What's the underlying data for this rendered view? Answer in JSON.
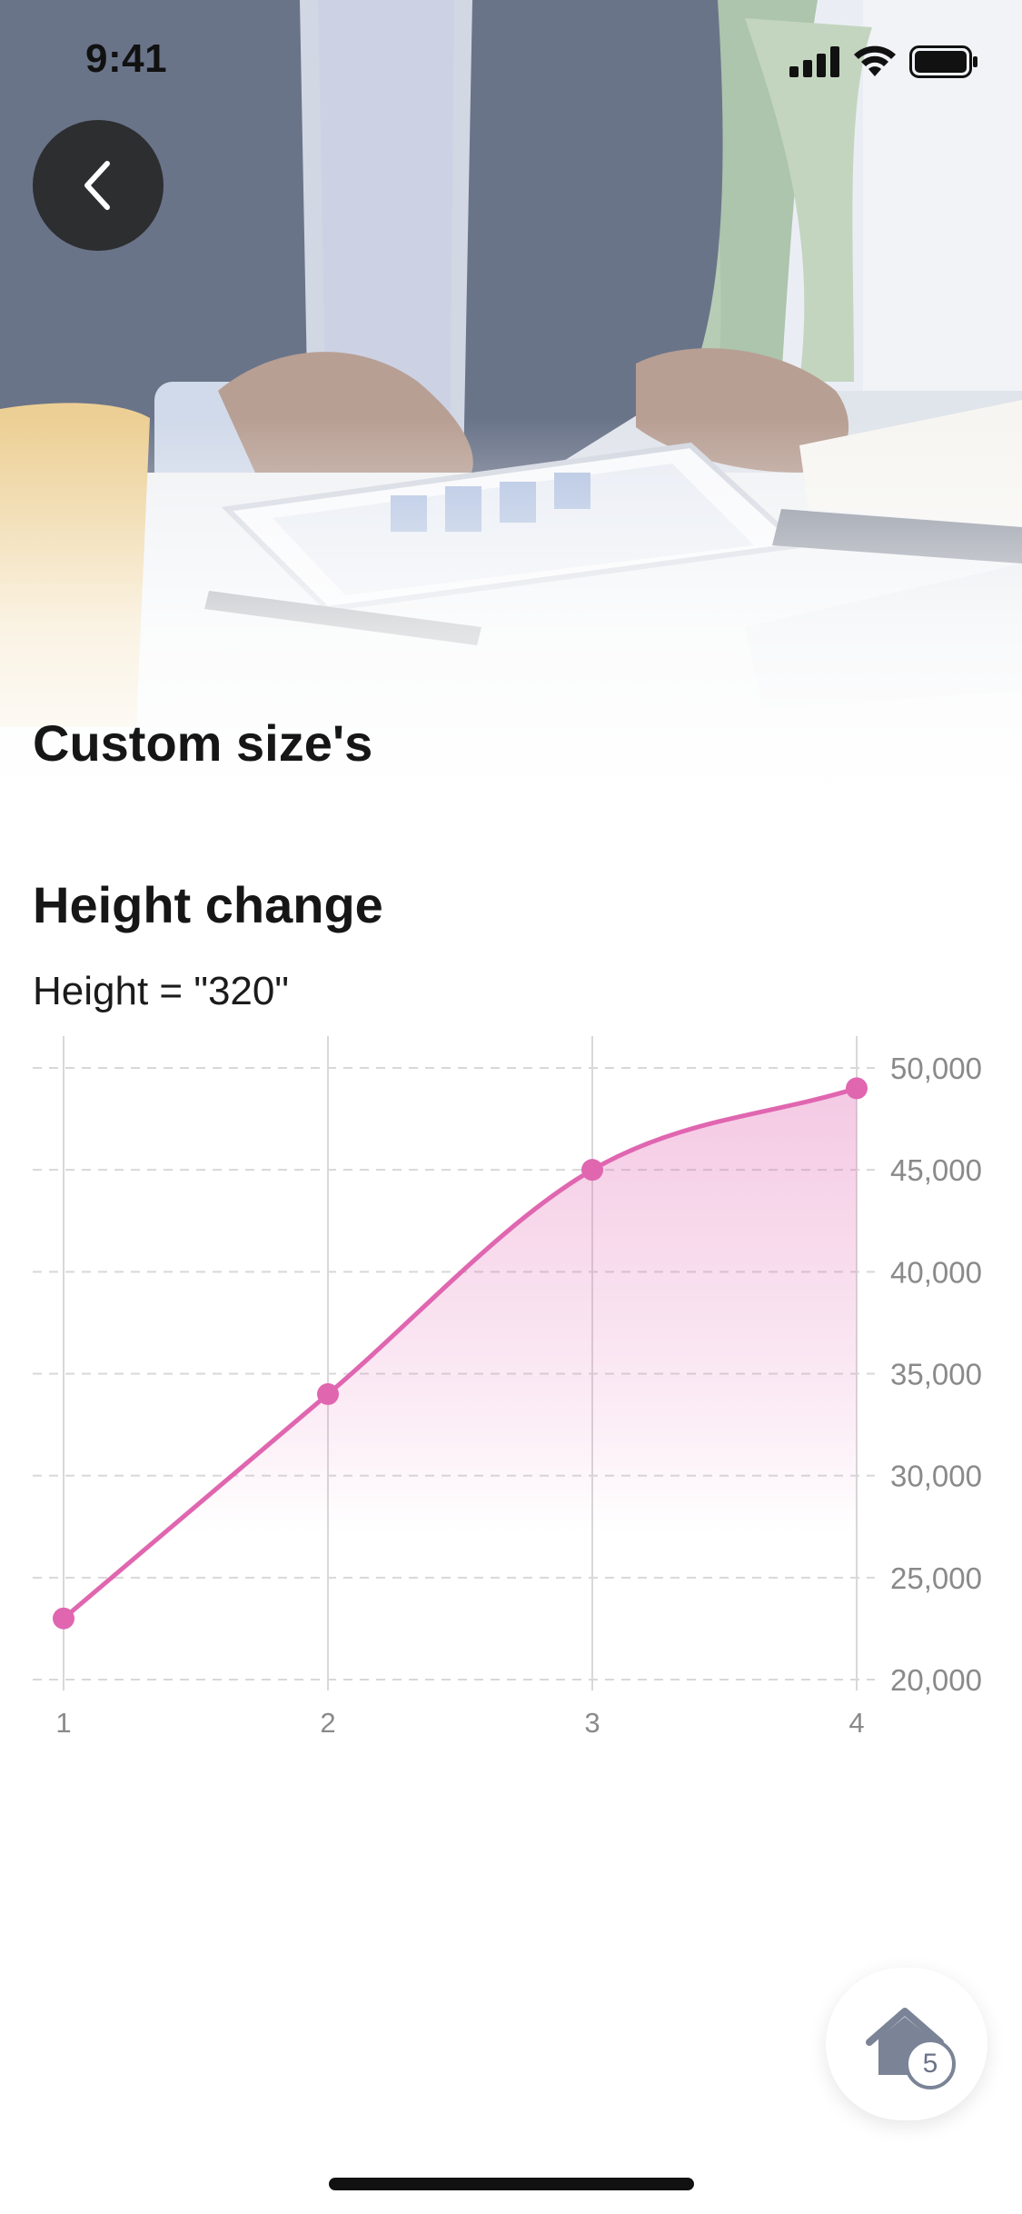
{
  "status_bar": {
    "time": "9:41"
  },
  "header": {
    "title": "Custom size's"
  },
  "section": {
    "title": "Height change",
    "subtitle": "Height = \"320\""
  },
  "home_button": {
    "badge_count": "5"
  },
  "colors": {
    "accent": "#e066b0",
    "grid": "#d8d8d8",
    "axis_text": "#8a8a8a"
  },
  "icons": {
    "back": "chevron-left-icon",
    "home": "home-icon"
  },
  "chart_data": {
    "type": "area",
    "x": [
      1,
      2,
      3,
      4
    ],
    "values": [
      23000,
      34000,
      45000,
      49000
    ],
    "x_tick_labels": [
      "1",
      "2",
      "3",
      "4"
    ],
    "y_tick_labels": [
      "50,000",
      "45,000",
      "40,000",
      "35,000",
      "30,000",
      "25,000",
      "20,000"
    ],
    "y_ticks": [
      50000,
      45000,
      40000,
      35000,
      30000,
      25000,
      20000
    ],
    "ylim": [
      20000,
      50000
    ],
    "xlim": [
      1,
      4
    ],
    "y_axis_position": "right",
    "grid": true,
    "curve": "smooth",
    "markers": true
  }
}
